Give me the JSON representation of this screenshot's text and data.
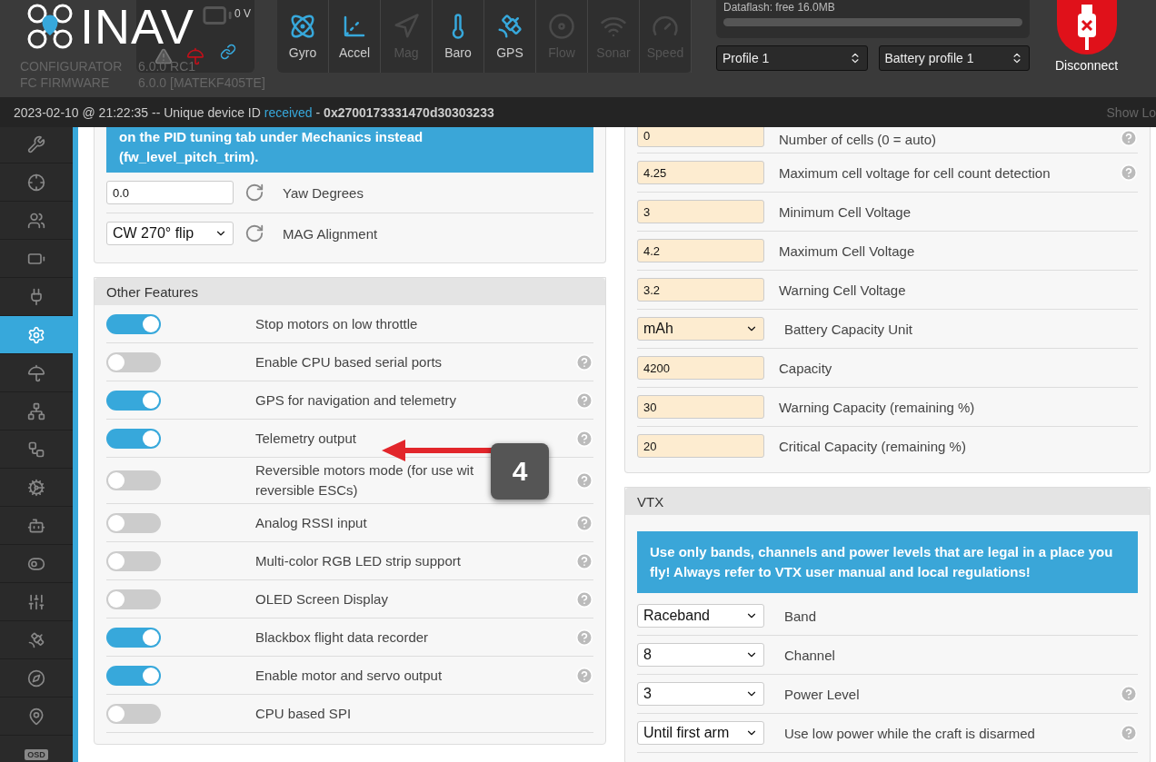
{
  "header": {
    "logo": "INAV",
    "voltage": "0 V",
    "versions": [
      {
        "label": "CONFIGURATOR",
        "value": "6.0.0 RC1"
      },
      {
        "label": "FC FIRMWARE",
        "value": "6.0.0 [MATEKF405TE]"
      }
    ],
    "sensors": [
      {
        "kind": "gyro",
        "label": "Gyro",
        "active": true
      },
      {
        "kind": "accel",
        "label": "Accel",
        "active": true
      },
      {
        "kind": "mag",
        "label": "Mag",
        "active": false
      },
      {
        "kind": "baro",
        "label": "Baro",
        "active": true
      },
      {
        "kind": "gps",
        "label": "GPS",
        "active": true
      },
      {
        "kind": "flow",
        "label": "Flow",
        "active": false
      },
      {
        "kind": "sonar",
        "label": "Sonar",
        "active": false
      },
      {
        "kind": "speed",
        "label": "Speed",
        "active": false
      }
    ],
    "dataflash": {
      "label": "Dataflash: free 16.0MB",
      "level": 0
    },
    "profiles": [
      "Profile 1",
      "Battery profile 1"
    ],
    "disconnect": "Disconnect"
  },
  "status_bar": {
    "text": "2023-02-10 @ 21:22:35 -- Unique device ID",
    "status": "received",
    "device_id": "- **0x2700173331470d30303233**",
    "show_log": "Show Lo"
  },
  "sidebar": {
    "items": [
      {
        "kind": "wrench",
        "selected": false
      },
      {
        "kind": "crosshair",
        "selected": false
      },
      {
        "kind": "users",
        "selected": false
      },
      {
        "kind": "battery",
        "selected": false
      },
      {
        "kind": "plug",
        "selected": false
      },
      {
        "kind": "settings",
        "selected": true
      },
      {
        "kind": "umbrella",
        "selected": false
      },
      {
        "kind": "network",
        "selected": false
      },
      {
        "kind": "workflow",
        "selected": false
      },
      {
        "kind": "cog",
        "selected": false
      },
      {
        "kind": "bot",
        "selected": false
      },
      {
        "kind": "toggles",
        "selected": false
      },
      {
        "kind": "sliders",
        "selected": false
      },
      {
        "kind": "satellite",
        "selected": false
      },
      {
        "kind": "compass",
        "selected": false
      },
      {
        "kind": "pin",
        "selected": false
      },
      {
        "kind": "osd",
        "label": "OSD",
        "selected": false
      }
    ]
  },
  "alignment_panel": {
    "notice": [
      "on the PID tuning tab under Mechanics instead",
      "(**fw_level_pitch_trim**)."
    ],
    "rows": [
      {
        "kind": "input",
        "value": "0.0",
        "label": "Yaw Degrees"
      },
      {
        "kind": "select",
        "value": "CW 270° flip",
        "label": "MAG Alignment"
      }
    ]
  },
  "other_features": {
    "title": "Other Features",
    "rows": [
      {
        "label": [
          "Stop motors on low throttle"
        ],
        "on": true,
        "help": false
      },
      {
        "label": [
          "Enable CPU based serial ports"
        ],
        "on": false,
        "help": true
      },
      {
        "label": [
          "GPS for navigation and telemetry"
        ],
        "on": true,
        "help": true
      },
      {
        "label": [
          "Telemetry output"
        ],
        "on": true,
        "help": true
      },
      {
        "label": [
          "Reversible motors mode (for use wit",
          "reversible ESCs)"
        ],
        "on": false,
        "help": true
      },
      {
        "label": [
          "Analog RSSI input"
        ],
        "on": false,
        "help": true
      },
      {
        "label": [
          "Multi-color RGB LED strip support"
        ],
        "on": false,
        "help": true
      },
      {
        "label": [
          "OLED Screen Display"
        ],
        "on": false,
        "help": true
      },
      {
        "label": [
          "Blackbox flight data recorder"
        ],
        "on": true,
        "help": true
      },
      {
        "label": [
          "Enable motor and servo output"
        ],
        "on": true,
        "help": true
      },
      {
        "label": [
          "CPU based SPI"
        ],
        "on": false,
        "help": false
      }
    ]
  },
  "battery_panel": {
    "rows": [
      {
        "kind": "input",
        "value": "0",
        "label": "Number of cells (0 = auto)",
        "help": true
      },
      {
        "kind": "input",
        "value": "4.25",
        "label": "Maximum cell voltage for cell count detection",
        "help": true
      },
      {
        "kind": "input",
        "value": "3",
        "label": "Minimum Cell Voltage",
        "help": false
      },
      {
        "kind": "input",
        "value": "4.2",
        "label": "Maximum Cell Voltage",
        "help": false
      },
      {
        "kind": "input",
        "value": "3.2",
        "label": "Warning Cell Voltage",
        "help": false
      },
      {
        "kind": "select",
        "value": "mAh",
        "label": "Battery Capacity Unit",
        "help": false
      },
      {
        "kind": "input",
        "value": "4200",
        "label": "Capacity",
        "help": false
      },
      {
        "kind": "input",
        "value": "30",
        "label": "Warning Capacity (remaining %)",
        "help": false
      },
      {
        "kind": "input",
        "value": "20",
        "label": "Critical Capacity (remaining %)",
        "help": false
      }
    ]
  },
  "vtx_panel": {
    "title": "VTX",
    "notice": "Use only bands, channels and power levels that are legal in a place you fly! Always refer to VTX user manual and local regulations!",
    "rows": [
      {
        "value": "Raceband",
        "label": "Band",
        "help": false
      },
      {
        "value": "8",
        "label": "Channel",
        "help": false
      },
      {
        "value": "3",
        "label": "Power Level",
        "help": true
      },
      {
        "value": "Until first arm",
        "label": "Use low power while the craft is disarmed",
        "help": true
      }
    ]
  },
  "annotation": {
    "number": "4"
  }
}
